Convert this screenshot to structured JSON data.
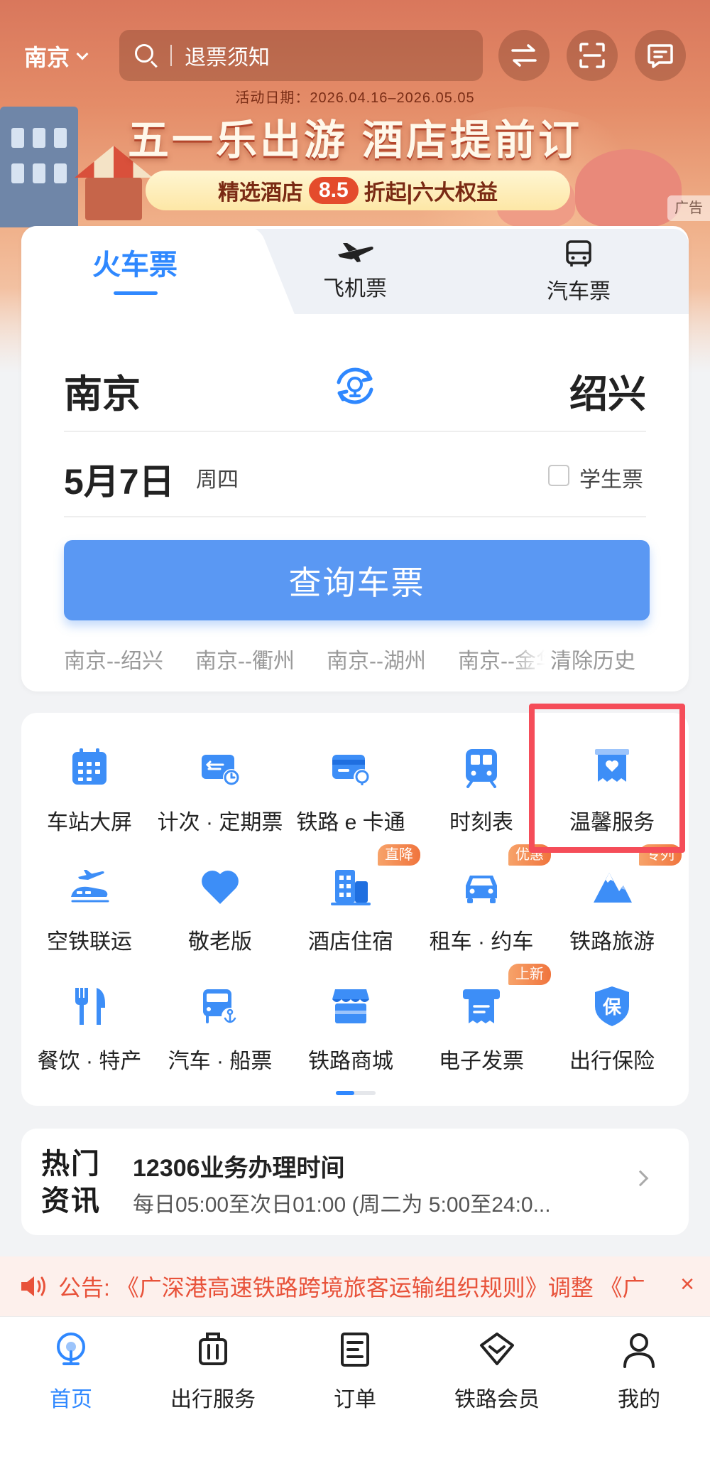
{
  "header": {
    "city": "南京",
    "search_placeholder": "退票须知"
  },
  "banner": {
    "date": "活动日期：2026.04.16–2026.05.05",
    "title": "五一乐出游 酒店提前订",
    "pill_prefix": "精选酒店",
    "pill_discount": "8.5",
    "pill_suffix": "折起|六大权益",
    "ad": "广告"
  },
  "tabs": {
    "train": "火车票",
    "plane": "飞机票",
    "bus": "汽车票"
  },
  "ticket": {
    "from": "南京",
    "to": "绍兴",
    "date": "5月7日",
    "weekday": "周四",
    "student": "学生票",
    "query_button": "查询车票",
    "history": [
      "南京--绍兴",
      "南京--衢州",
      "南京--湖州",
      "南京--金华"
    ],
    "clear_history": "清除历史"
  },
  "services": [
    {
      "label": "车站大屏",
      "icon": "station-screen-icon"
    },
    {
      "label": "计次 · 定期票",
      "icon": "ticket-pass-icon"
    },
    {
      "label": "铁路 e 卡通",
      "icon": "ecard-icon"
    },
    {
      "label": "时刻表",
      "icon": "timetable-icon"
    },
    {
      "label": "温馨服务",
      "icon": "heart-service-icon"
    },
    {
      "label": "空铁联运",
      "icon": "air-rail-icon"
    },
    {
      "label": "敬老版",
      "icon": "heart-icon"
    },
    {
      "label": "酒店住宿",
      "icon": "hotel-icon",
      "tag": "直降"
    },
    {
      "label": "租车 · 约车",
      "icon": "car-icon",
      "tag": "优惠"
    },
    {
      "label": "铁路旅游",
      "icon": "mountain-icon",
      "tag": "专列"
    },
    {
      "label": "餐饮 · 特产",
      "icon": "dining-icon"
    },
    {
      "label": "汽车 · 船票",
      "icon": "bus-ship-icon"
    },
    {
      "label": "铁路商城",
      "icon": "store-icon"
    },
    {
      "label": "电子发票",
      "icon": "invoice-icon",
      "tag": "上新"
    },
    {
      "label": "出行保险",
      "icon": "insurance-icon",
      "badge": "保"
    }
  ],
  "news": {
    "hot_line1": "热门",
    "hot_line2": "资讯",
    "title": "12306业务办理时间",
    "subtitle": "每日05:00至次日01:00 (周二为 5:00至24:0..."
  },
  "notice": {
    "text": "公告: 《广深港高速铁路跨境旅客运输组织规则》调整 《广",
    "close": "×"
  },
  "nav": [
    {
      "label": "首页",
      "active": true
    },
    {
      "label": "出行服务",
      "active": false
    },
    {
      "label": "订单",
      "active": false
    },
    {
      "label": "铁路会员",
      "active": false
    },
    {
      "label": "我的",
      "active": false
    }
  ],
  "colors": {
    "accent": "#2f88ff",
    "button": "#5a98f3",
    "highlight": "#f54d59",
    "notice": "#e8523a"
  }
}
